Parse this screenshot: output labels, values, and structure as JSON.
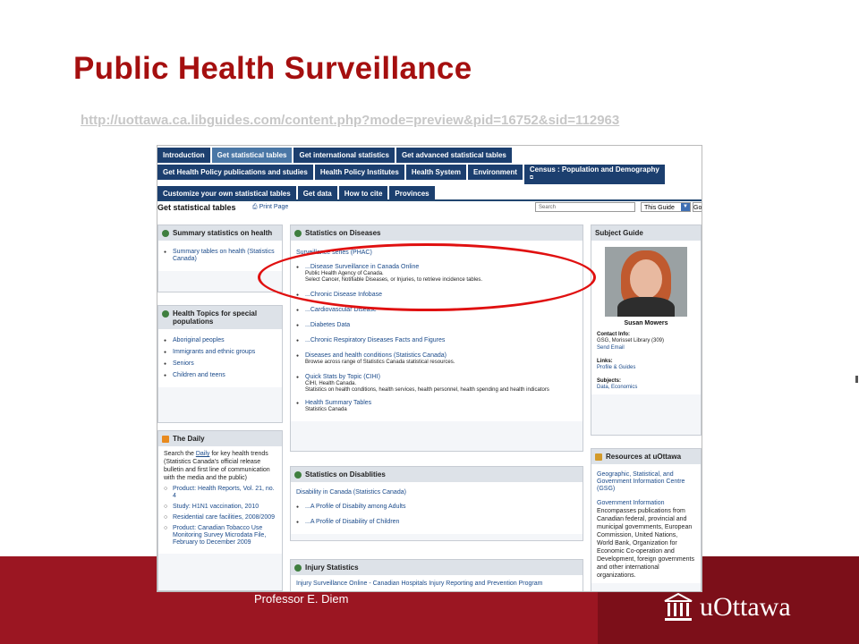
{
  "slide": {
    "title": "Public Health Surveillance",
    "link": "http://uottawa.ca.libguides.com/content.php?mode=preview&pid=16752&sid=112963",
    "footer_text": "Professor E. Diem",
    "logo_text": "uOttawa"
  },
  "tabs": {
    "row1": [
      "Introduction",
      "Get statistical tables",
      "Get international statistics",
      "Get advanced statistical tables"
    ],
    "row2": [
      "Get Health Policy publications and studies",
      "Health Policy Institutes",
      "Health System",
      "Environment",
      "Census : Population and Demography"
    ],
    "row3": [
      "Customize your own statistical tables",
      "Get data",
      "How to cite",
      "Provinces"
    ]
  },
  "toolbar": {
    "page_title": "Get statistical tables",
    "print_label": "Print Page",
    "search_placeholder": "Search",
    "scope_value": "This Guide",
    "go_label": "Go"
  },
  "left": {
    "summary": {
      "title": "Summary statistics on health",
      "items": [
        "Summary tables on health (Statistics Canada)"
      ]
    },
    "topics": {
      "title": "Health Topics for special populations",
      "items": [
        "Aboriginal peoples",
        "Immigrants and ethnic groups",
        "Seniors",
        "Children and teens"
      ]
    },
    "daily": {
      "title": "The Daily",
      "intro_pre": "Search the ",
      "intro_link": "Daily",
      "intro_post": " for key health trends (Statistics Canada's official release bulletin and first line of communication with the media and the public)",
      "items": [
        "Product: Health Reports, Vol. 21, no. 4",
        "Study: H1N1 vaccination, 2010",
        "Residential care facilities, 2008/2009",
        "Product: Canadian Tobacco Use Monitoring Survey Microdata File, February to December 2009"
      ]
    }
  },
  "middle": {
    "diseases": {
      "title": "Statistics on Diseases",
      "series": "Surveillance series (PHAC)",
      "items": [
        {
          "title": "...Disease Surveillance in Canada Online",
          "desc1": "Public Health Agency of Canada.",
          "desc2": "Select Cancer, Notifiable Diseases, or Injuries, to retrieve incidence tables."
        },
        {
          "title": "...Chronic Disease Infobase"
        },
        {
          "title": "...Cardiovascular Disease"
        },
        {
          "title": "...Diabetes Data"
        },
        {
          "title": "...Chronic Respiratory Diseases Facts and Figures"
        },
        {
          "title": "Diseases and health conditions (Statistics Canada)",
          "desc1": "Browse across range of Statistics Canada statistical resources."
        },
        {
          "title": "Quick Stats by Topic (CIHI)",
          "desc1": "CIHI, Health Canada.",
          "desc2": "Statistics on health conditions, health services, health personnel, health spending and health indicators"
        },
        {
          "title": "Health Summary Tables",
          "desc1": "Statistics Canada"
        }
      ]
    },
    "disabilities": {
      "title": "Statistics on Disablities",
      "link": "Disability in Canada (Statistics Canada)",
      "items": [
        "...A Profile of Disabilty among Adults",
        "...A Profile of Disability of Children"
      ]
    },
    "injury": {
      "title": "Injury Statistics",
      "link": "Injury Surveillance Online - Canadian Hospitals Injury Reporting and Prevention Program"
    }
  },
  "right": {
    "guide": {
      "title": "Subject Guide",
      "name": "Susan Mowers",
      "contact_label": "Contact Info:",
      "contact_value": "GSG, Morisset Library (309)",
      "send_email": "Send Email",
      "links_label": "Links:",
      "links_value": "Profile & Guides",
      "subjects_label": "Subjects:",
      "subjects_value": "Data, Economics"
    },
    "resources": {
      "title": "Resources at uOttawa",
      "gsg_link": "Geographic, Statistical, and Government Information Centre (GSG)",
      "gov_link": "Government Information",
      "gov_desc": "Encompasses publications from Canadian federal, provincial and municipal governments, European Commission, United Nations, World Bank, Organization for Economic Co-operation and Development, foreign governments and other international organizations."
    }
  },
  "colors": {
    "title": "#a50f0f",
    "footer": "#9b1622",
    "tab": "#1c3f6f",
    "tab_active": "#4a77a6",
    "highlight": "#e01010"
  }
}
